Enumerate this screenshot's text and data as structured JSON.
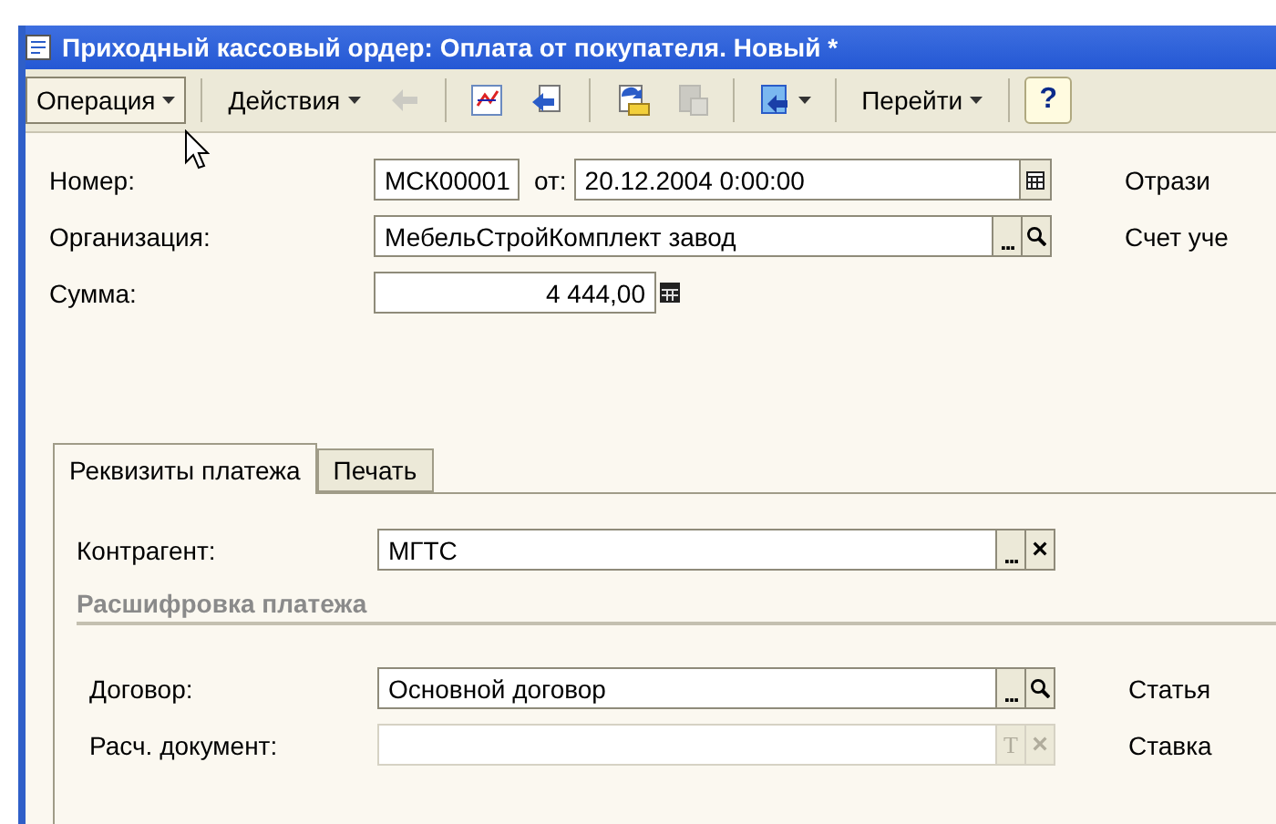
{
  "window": {
    "title": "Приходный кассовый ордер: Оплата от покупателя. Новый *"
  },
  "toolbar": [
    {
      "kind": "menu",
      "label": "Операция",
      "pressed": true
    },
    {
      "kind": "separator"
    },
    {
      "kind": "menu",
      "label": "Действия",
      "pressed": false
    },
    {
      "kind": "icon",
      "disabled": true
    },
    {
      "kind": "separator"
    },
    {
      "kind": "icon",
      "disabled": false
    },
    {
      "kind": "icon",
      "disabled": false
    },
    {
      "kind": "separator"
    },
    {
      "kind": "icon",
      "disabled": false
    },
    {
      "kind": "icon",
      "disabled": true
    },
    {
      "kind": "separator"
    },
    {
      "kind": "icon-menu",
      "disabled": false
    },
    {
      "kind": "separator"
    },
    {
      "kind": "menu",
      "label": "Перейти",
      "pressed": false
    },
    {
      "kind": "separator"
    },
    {
      "kind": "help",
      "label": "?"
    }
  ],
  "header": {
    "number": {
      "label": "Номер:",
      "value": "МСК00001"
    },
    "date": {
      "label": "от:",
      "value": "20.12.2004 0:00:00",
      "buttons": [
        {
          "kind": "calendar"
        }
      ]
    },
    "organization": {
      "label": "Организация:",
      "value": "МебельСтройКомплект завод",
      "buttons": [
        {
          "kind": "choice",
          "label": "..."
        },
        {
          "kind": "search"
        }
      ]
    },
    "amount": {
      "label": "Сумма:",
      "value": "4 444,00",
      "buttons": [
        {
          "kind": "calculator"
        }
      ]
    },
    "side_labels": [
      "Отрази",
      "Счет уче"
    ]
  },
  "tabs": [
    {
      "label": "Реквизиты платежа",
      "selected": true
    },
    {
      "label": "Печать",
      "selected": false
    }
  ],
  "payment": {
    "counterparty": {
      "label": "Контрагент:",
      "value": "МГТС",
      "buttons": [
        {
          "kind": "choice",
          "label": "..."
        },
        {
          "kind": "clear",
          "label": "×"
        }
      ]
    },
    "section_title": "Расшифровка платежа",
    "rows": [
      {
        "label": "Договор:",
        "value": "Основной договор",
        "disabled": false,
        "side_label": "Статья",
        "buttons": [
          {
            "kind": "choice",
            "label": "..."
          },
          {
            "kind": "search"
          }
        ]
      },
      {
        "label": "Расч. документ:",
        "disabled": true,
        "side_label": "Ставка",
        "buttons": [
          {
            "kind": "type",
            "label": "T"
          },
          {
            "kind": "clear",
            "label": "×"
          }
        ]
      }
    ]
  }
}
